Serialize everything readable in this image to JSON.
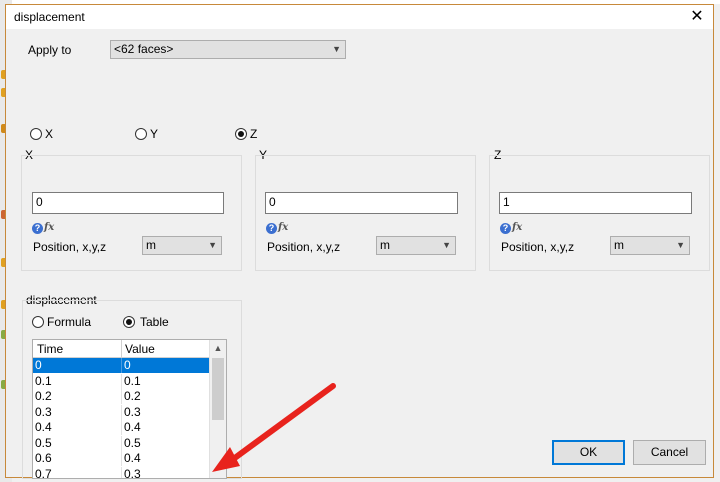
{
  "window": {
    "title": "displacement",
    "close_glyph": "✕"
  },
  "apply_to": {
    "label": "Apply to",
    "value": "<62 faces>"
  },
  "axis_radios": [
    {
      "label": "X",
      "checked": false
    },
    {
      "label": "Y",
      "checked": false
    },
    {
      "label": "Z",
      "checked": true
    }
  ],
  "groups": [
    {
      "title": "X",
      "value": "0",
      "position_label": "Position, x,y,z",
      "unit": "m"
    },
    {
      "title": "Y",
      "value": "0",
      "position_label": "Position, x,y,z",
      "unit": "m"
    },
    {
      "title": "Z",
      "value": "1",
      "position_label": "Position, x,y,z",
      "unit": "m"
    }
  ],
  "displacement": {
    "title": "displacement",
    "mode_radios": [
      {
        "label": "Formula",
        "checked": false
      },
      {
        "label": "Table",
        "checked": true
      }
    ],
    "table": {
      "columns": [
        "Time",
        "Value"
      ],
      "rows": [
        [
          "0",
          "0"
        ],
        [
          "0.1",
          "0.1"
        ],
        [
          "0.2",
          "0.2"
        ],
        [
          "0.3",
          "0.3"
        ],
        [
          "0.4",
          "0.4"
        ],
        [
          "0.5",
          "0.5"
        ],
        [
          "0.6",
          "0.4"
        ],
        [
          "0.7",
          "0.3"
        ]
      ],
      "selected_row": 0
    }
  },
  "buttons": {
    "ok": "OK",
    "cancel": "Cancel"
  },
  "icons": {
    "help": "?",
    "fx": "fx",
    "arrow": "▲"
  },
  "colors": {
    "annotation_arrow": "#e8231d",
    "selection": "#0078d7"
  }
}
